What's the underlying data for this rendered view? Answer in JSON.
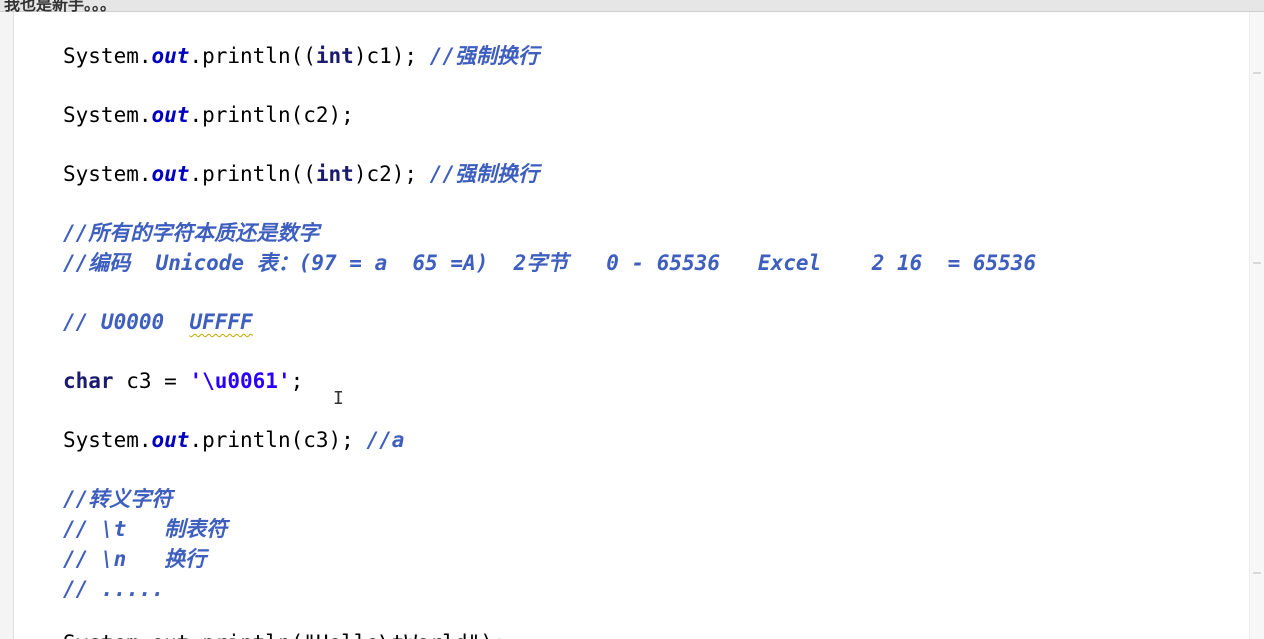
{
  "top_strip": {
    "text": "我也是新手。。。"
  },
  "code": {
    "line1": {
      "prefix": "System.",
      "field": "out",
      "call": ".println((",
      "kw": "int",
      "rest": ")c1); ",
      "comment": "//强制换行"
    },
    "line2": {
      "prefix": "System.",
      "field": "out",
      "call": ".println(c2);"
    },
    "line3": {
      "prefix": "System.",
      "field": "out",
      "call": ".println((",
      "kw": "int",
      "rest": ")c2); ",
      "comment": "//强制换行"
    },
    "comment1": "//所有的字符本质还是数字",
    "comment2": "//编码  Unicode 表：(97 = a  65 =A)  2字节   0 - 65536   Excel    2 16  = 65536",
    "comment3_prefix": "// U0000  ",
    "comment3_squiggle": "UFFFF",
    "line4": {
      "kw": "char",
      "rest": " c3 = ",
      "str": "'\\u0061'",
      "end": ";"
    },
    "line5": {
      "prefix": "System.",
      "field": "out",
      "call": ".println(c3); ",
      "comment": "//a"
    },
    "comment4": "//转义字符",
    "comment5": "// \\t   制表符",
    "comment6": "// \\n   换行",
    "comment7": "// .....",
    "line6_partial": "System.out.println(\"Hello\\tWorld\");"
  },
  "cursor": {
    "glyph": "I"
  }
}
